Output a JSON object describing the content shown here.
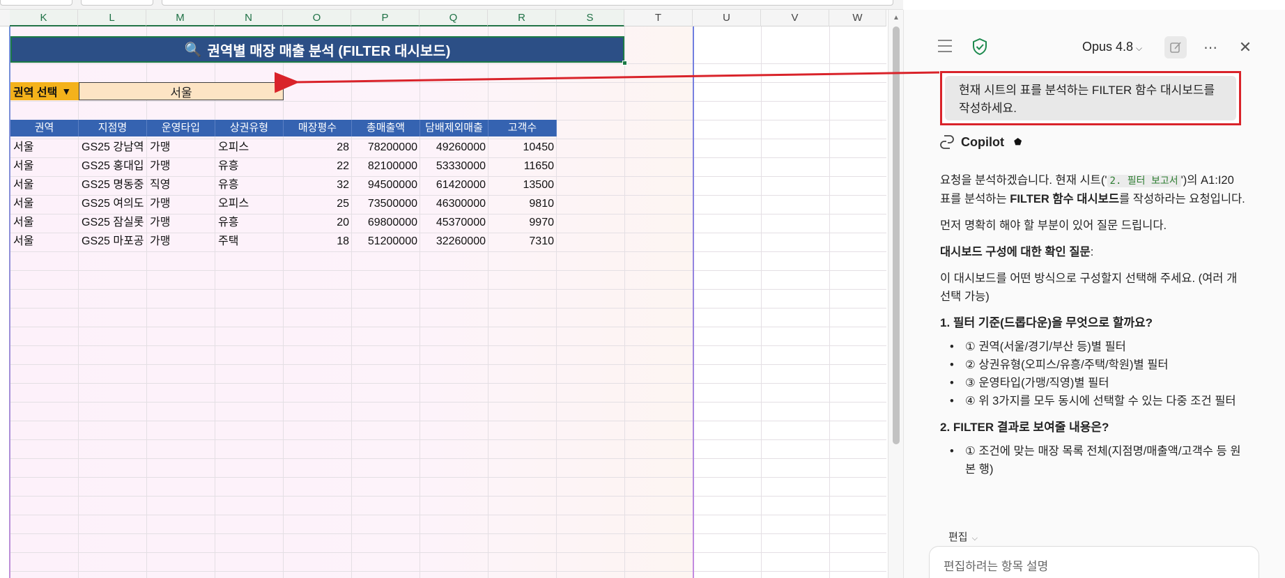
{
  "columns": [
    "K",
    "L",
    "M",
    "N",
    "O",
    "P",
    "Q",
    "R",
    "S",
    "T",
    "U",
    "V",
    "W"
  ],
  "sheet": {
    "title_icon": "magnifier-icon",
    "title": "권역별 매장 매출 분석 (FILTER 대시보드)",
    "region_label": "권역 선택",
    "region_dropdown_glyph": "▼",
    "region_value": "서울",
    "table": {
      "headers": [
        "권역",
        "지점명",
        "운영타입",
        "상권유형",
        "매장평수",
        "총매출액",
        "담배제외매출",
        "고객수"
      ],
      "rows": [
        [
          "서울",
          "GS25 강남역",
          "가맹",
          "오피스",
          "28",
          "78200000",
          "49260000",
          "10450"
        ],
        [
          "서울",
          "GS25 홍대입",
          "가맹",
          "유흥",
          "22",
          "82100000",
          "53330000",
          "11650"
        ],
        [
          "서울",
          "GS25 명동중",
          "직영",
          "유흥",
          "32",
          "94500000",
          "61420000",
          "13500"
        ],
        [
          "서울",
          "GS25 여의도",
          "가맹",
          "오피스",
          "25",
          "73500000",
          "46300000",
          "9810"
        ],
        [
          "서울",
          "GS25 잠실롯",
          "가맹",
          "유흥",
          "20",
          "69800000",
          "45370000",
          "9970"
        ],
        [
          "서울",
          "GS25 마포공",
          "가맹",
          "주택",
          "18",
          "51200000",
          "32260000",
          "7310"
        ]
      ]
    },
    "colors": {
      "banner": "#2c4f86",
      "header": "#3563b1",
      "label": "#f4b21b",
      "input": "#fde4c4",
      "annotation": "#d9232a"
    }
  },
  "pane": {
    "model": "Opus 4.8",
    "user_message": "현재 시트의 표를 분석하는 FILTER 함수 대시보드를 작성하세요.",
    "assistant_name": "Copilot",
    "response": {
      "p1_a": "요청을 분석하겠습니다. 현재 시트('",
      "p1_code": "2. 필터 보고서",
      "p1_b": "')의 A1:I20 표를 분석하는 ",
      "p1_bold": "FILTER 함수 대시보드",
      "p1_c": "를 작성하라는 요청입니다.",
      "p2": "먼저 명확히 해야 할 부분이 있어 질문 드립니다.",
      "p3_bold": "대시보드 구성에 대한 확인 질문",
      "p3_colon": ":",
      "p4": "이 대시보드를 어떤 방식으로 구성할지 선택해 주세요. (여러 개 선택 가능)",
      "q1": "1. 필터 기준(드롭다운)을 무엇으로 할까요?",
      "q1_items": [
        "① 권역(서울/경기/부산 등)별 필터",
        "② 상권유형(오피스/유흥/주택/학원)별 필터",
        "③ 운영타입(가맹/직영)별 필터",
        "④ 위 3가지를 모두 동시에 선택할 수 있는 다중 조건 필터"
      ],
      "q2": "2. FILTER 결과로 보여줄 내용은?",
      "q2_items": [
        "① 조건에 맞는 매장 목록 전체(지점명/매출액/고객수 등 원본 행)"
      ]
    },
    "edit_label": "편집",
    "input_placeholder": "편집하려는 항목 설명",
    "icons": [
      "hamburger-icon",
      "shield-check-icon",
      "chevron-down-icon",
      "new-chat-icon",
      "more-icon",
      "close-icon",
      "copilot-logo-icon",
      "shield-badge-icon"
    ]
  }
}
